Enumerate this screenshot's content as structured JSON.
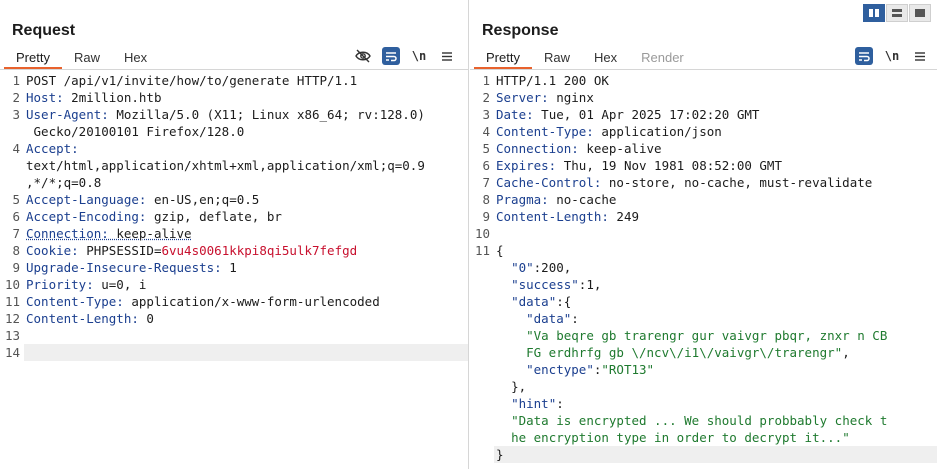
{
  "layout_toggle": [
    "split-vertical",
    "split-horizontal",
    "tabs"
  ],
  "request": {
    "title": "Request",
    "tabs": [
      {
        "label": "Pretty",
        "active": true
      },
      {
        "label": "Raw"
      },
      {
        "label": "Hex"
      }
    ],
    "toolbar": {
      "wrap_label": "\\n",
      "icons": [
        "eye-off-icon",
        "wrap-lines-icon",
        "newline-toggle",
        "menu-icon"
      ]
    },
    "lines": [
      {
        "n": "1",
        "text": "POST /api/v1/invite/how/to/generate HTTP/1.1"
      },
      {
        "n": "2",
        "key": "Host:",
        "val": " 2million.htb"
      },
      {
        "n": "3",
        "key": "User-Agent:",
        "val": " Mozilla/5.0 (X11; Linux x86_64; rv:128.0)"
      },
      {
        "n": "",
        "text": " Gecko/20100101 Firefox/128.0"
      },
      {
        "n": "4",
        "key": "Accept:",
        "val": ""
      },
      {
        "n": "",
        "text": "text/html,application/xhtml+xml,application/xml;q=0.9"
      },
      {
        "n": "",
        "text": ",*/*;q=0.8"
      },
      {
        "n": "5",
        "key": "Accept-Language:",
        "val": " en-US,en;q=0.5"
      },
      {
        "n": "6",
        "key": "Accept-Encoding:",
        "val": " gzip, deflate, br"
      },
      {
        "n": "7",
        "key": "Connection:",
        "val": " keep-alive"
      },
      {
        "n": "8",
        "key": "Cookie:",
        "val": " PHPSESSID=",
        "cookie": "6vu4s0061kkpi8qi5ulk7fefgd"
      },
      {
        "n": "9",
        "key": "Upgrade-Insecure-Requests:",
        "val": " 1"
      },
      {
        "n": "10",
        "key": "Priority:",
        "val": " u=0, i"
      },
      {
        "n": "11",
        "key": "Content-Type:",
        "val": " application/x-www-form-urlencoded"
      },
      {
        "n": "12",
        "key": "Content-Length:",
        "val": " 0"
      },
      {
        "n": "13",
        "text": ""
      },
      {
        "n": "14",
        "text": ""
      }
    ]
  },
  "response": {
    "title": "Response",
    "tabs": [
      {
        "label": "Pretty",
        "active": true
      },
      {
        "label": "Raw"
      },
      {
        "label": "Hex"
      },
      {
        "label": "Render",
        "disabled": true
      }
    ],
    "toolbar": {
      "wrap_label": "\\n",
      "icons": [
        "wrap-lines-icon",
        "newline-toggle",
        "menu-icon"
      ]
    },
    "lines": [
      {
        "n": "1",
        "text": "HTTP/1.1 200 OK"
      },
      {
        "n": "2",
        "key": "Server:",
        "val": " nginx"
      },
      {
        "n": "3",
        "key": "Date:",
        "val": " Tue, 01 Apr 2025 17:02:20 GMT"
      },
      {
        "n": "4",
        "key": "Content-Type:",
        "val": " application/json"
      },
      {
        "n": "5",
        "key": "Connection:",
        "val": " keep-alive"
      },
      {
        "n": "6",
        "key": "Expires:",
        "val": " Thu, 19 Nov 1981 08:52:00 GMT"
      },
      {
        "n": "7",
        "key": "Cache-Control:",
        "val": " no-store, no-cache, must-revalidate"
      },
      {
        "n": "8",
        "key": "Pragma:",
        "val": " no-cache"
      },
      {
        "n": "9",
        "key": "Content-Length:",
        "val": " 249"
      },
      {
        "n": "10",
        "text": ""
      },
      {
        "n": "11",
        "text": "{"
      },
      {
        "n": "",
        "indent": "  ",
        "jkey": "\"0\"",
        "sep": ":",
        "num": "200",
        "tail": ","
      },
      {
        "n": "",
        "indent": "  ",
        "jkey": "\"success\"",
        "sep": ":",
        "num": "1",
        "tail": ","
      },
      {
        "n": "",
        "indent": "  ",
        "jkey": "\"data\"",
        "sep": ":{",
        "tail": ""
      },
      {
        "n": "",
        "indent": "    ",
        "jkey": "\"data\"",
        "sep": ":",
        "tail": ""
      },
      {
        "n": "",
        "indent": "    ",
        "jstr": "\"Va beqre gb trarengr gur vaivgr pbqr, znxr n CB"
      },
      {
        "n": "",
        "indent": "    ",
        "jstr": "FG erdhrfg gb \\/ncv\\/i1\\/vaivgr\\/trarengr\"",
        "tail": ","
      },
      {
        "n": "",
        "indent": "    ",
        "jkey": "\"enctype\"",
        "sep": ":",
        "jstr": "\"ROT13\""
      },
      {
        "n": "",
        "indent": "  ",
        "text": "},"
      },
      {
        "n": "",
        "indent": "  ",
        "jkey": "\"hint\"",
        "sep": ":",
        "tail": ""
      },
      {
        "n": "",
        "indent": "  ",
        "jstr": "\"Data is encrypted ... We should probbably check t"
      },
      {
        "n": "",
        "indent": "  ",
        "jstr": "he encryption type in order to decrypt it...\""
      },
      {
        "n": "",
        "text": "}"
      }
    ]
  }
}
